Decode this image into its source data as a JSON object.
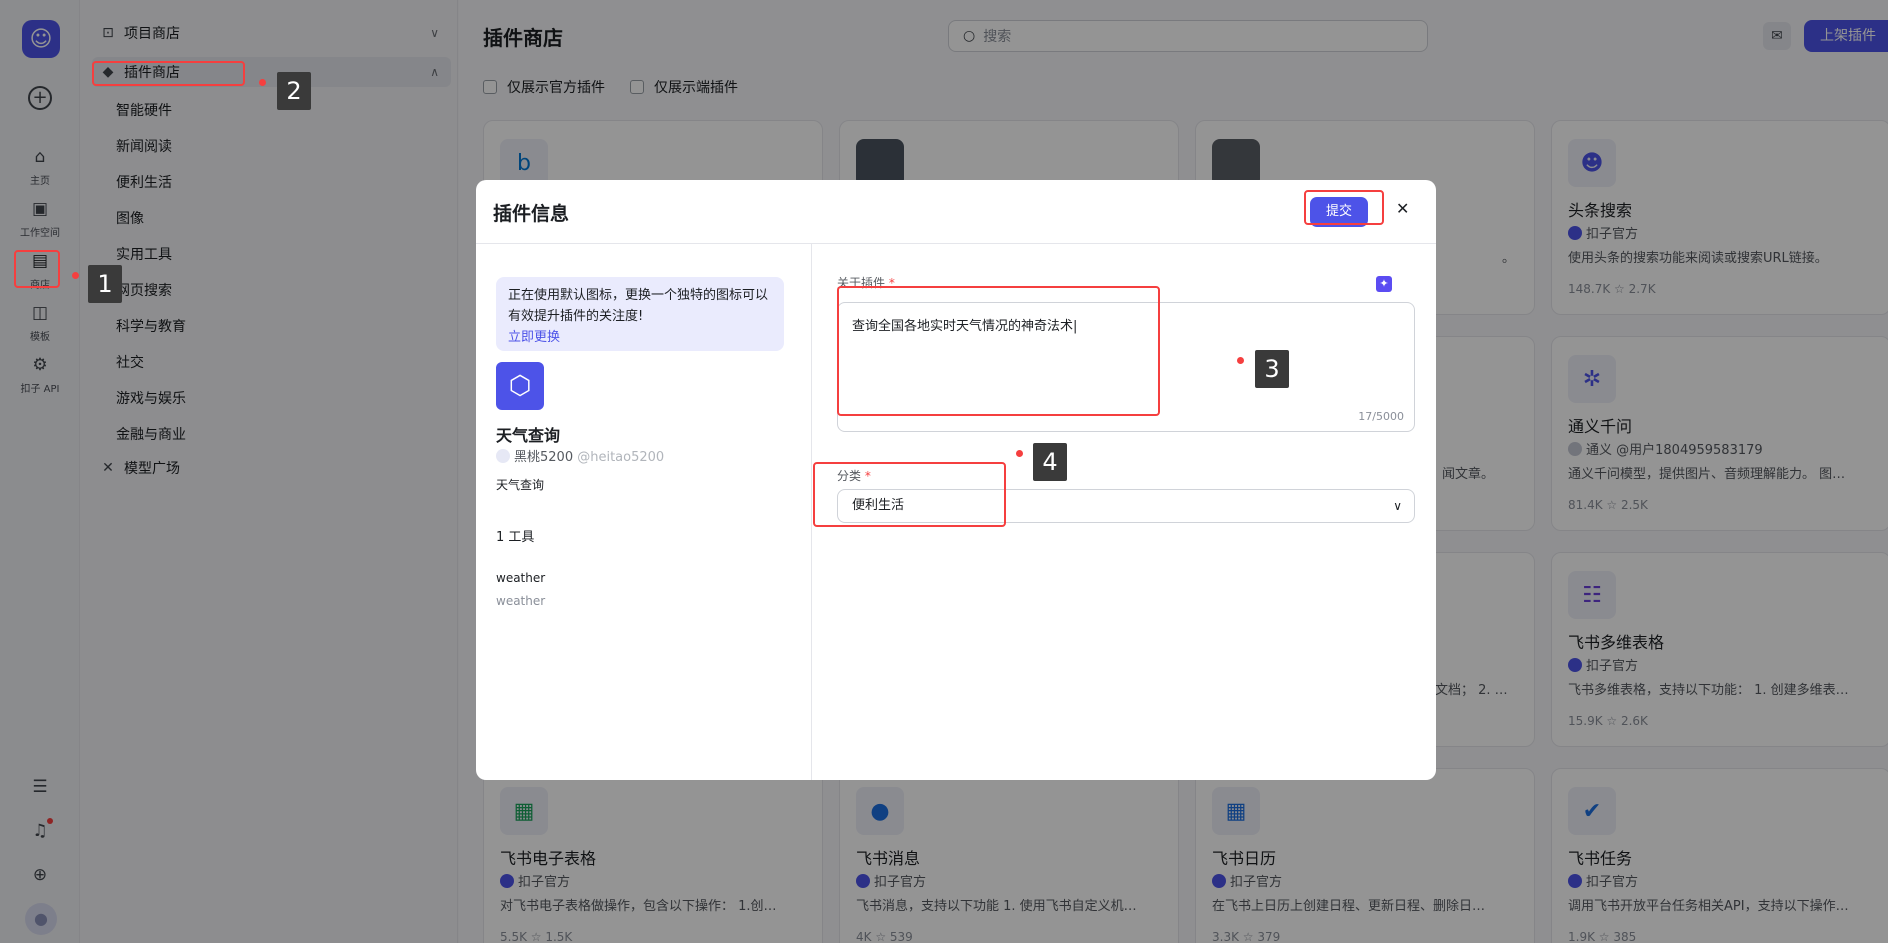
{
  "rail": {
    "items": [
      {
        "label": "主页"
      },
      {
        "label": "工作空间"
      },
      {
        "label": "商店"
      },
      {
        "label": "模板"
      },
      {
        "label": "扣子 API"
      }
    ]
  },
  "subnav": {
    "project_store": "项目商店",
    "plugin_store": "插件商店",
    "categories": [
      "智能硬件",
      "新闻阅读",
      "便利生活",
      "图像",
      "实用工具",
      "网页搜索",
      "科学与教育",
      "社交",
      "游戏与娱乐",
      "金融与商业"
    ],
    "model_plaza": "模型广场"
  },
  "main": {
    "title": "插件商店",
    "search_placeholder": "搜索",
    "publish_label": "上架插件",
    "filter_official": "仅展示官方插件",
    "filter_client": "仅展示端插件"
  },
  "cards": [
    {
      "name": "头条搜索",
      "author": "扣子官方",
      "desc": "使用头条的搜索功能来阅读或搜索URL链接。",
      "stats": "148.7K  ☆ 2.7K"
    },
    {
      "name": "通义千问",
      "author": "通义 @用户1804959583179",
      "desc": "通义千问模型，提供图片、音频理解能力。 图…",
      "stats": "81.4K  ☆ 2.5K"
    },
    {
      "name": "飞书多维表格",
      "author": "扣子官方",
      "desc": "飞书多维表格，支持以下功能： 1. 创建多维表…",
      "stats": "15.9K  ☆ 2.6K"
    },
    {
      "name": "飞书电子表格",
      "author": "扣子官方",
      "desc": "对飞书电子表格做操作，包含以下操作： 1.创…",
      "stats": "5.5K  ☆ 1.5K"
    },
    {
      "name": "飞书消息",
      "author": "扣子官方",
      "desc": "飞书消息，支持以下功能 1. 使用飞书自定义机…",
      "stats": "4K  ☆ 539"
    },
    {
      "name": "飞书日历",
      "author": "扣子官方",
      "desc": "在飞书上日历上创建日程、更新日程、删除日…",
      "stats": "3.3K  ☆ 379"
    },
    {
      "name": "飞书任务",
      "author": "扣子官方",
      "desc": "调用飞书开放平台任务相关API，支持以下操作…",
      "stats": "1.9K  ☆ 385"
    }
  ],
  "partial_texts": {
    "row1_col3_tail": "。",
    "row2_col3_tail": "闻文章。",
    "row3_col3_tail": "建文档； 2. …"
  },
  "modal": {
    "title": "插件信息",
    "submit_label": "提交",
    "tip_text": "正在使用默认图标，更换一个独特的图标可以有效提升插件的关注度!",
    "tip_link": "立即更换",
    "plugin_name": "天气查询",
    "author_name": "黑桃5200",
    "author_handle": "@heitao5200",
    "plugin_desc": "天气查询",
    "tools_count": "1 工具",
    "tool_name": "weather",
    "tool_desc": "weather",
    "about_label": "关于插件",
    "about_value": "查询全国各地实时天气情况的神奇法术",
    "about_counter": "17/5000",
    "category_label": "分类",
    "category_value": "便利生活"
  },
  "annotations": [
    "1",
    "2",
    "3",
    "4"
  ],
  "colors": {
    "accent": "#4d53e8",
    "highlight": "#f53f3f"
  }
}
